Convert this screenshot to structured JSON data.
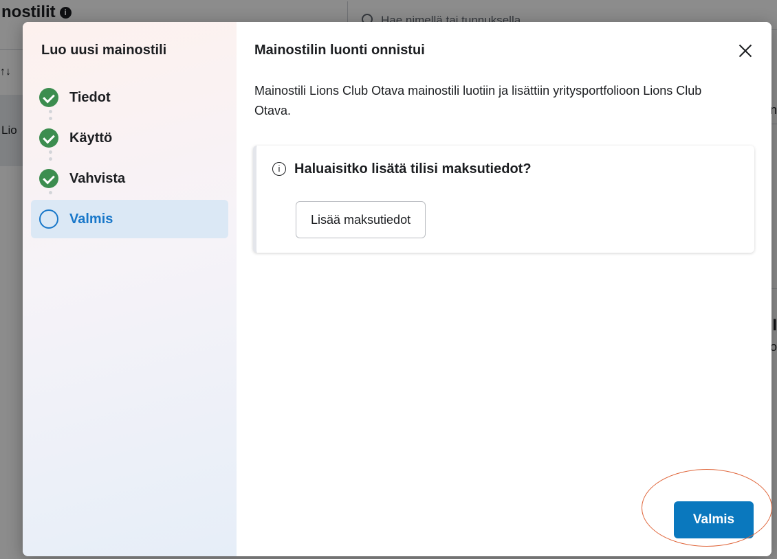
{
  "background": {
    "page_title": "nostilit",
    "search_placeholder": "Hae nimellä tai tunnuksella",
    "sort_symbol": "↑↓",
    "row_text": "Lio",
    "right_fragment_1": "n",
    "right_fragment_2": "I",
    "right_fragment_3": "o"
  },
  "sidebar": {
    "title": "Luo uusi mainostili",
    "steps": [
      {
        "label": "Tiedot",
        "state": "done"
      },
      {
        "label": "Käyttö",
        "state": "done"
      },
      {
        "label": "Vahvista",
        "state": "done"
      },
      {
        "label": "Valmis",
        "state": "current"
      }
    ]
  },
  "content": {
    "title": "Mainostilin luonti onnistui",
    "description": "Mainostili Lions Club Otava mainostili luotiin ja lisättiin yritysportfolioon Lions Club Otava.",
    "info_card": {
      "icon_glyph": "i",
      "title": "Haluaisitko lisätä tilisi maksutiedot?",
      "button_label": "Lisää maksutiedot"
    },
    "done_button_label": "Valmis"
  },
  "colors": {
    "primary": "#0a78be",
    "success": "#3c8d4f",
    "active_step": "#1877c9",
    "annotation_ring": "#e0673c"
  }
}
